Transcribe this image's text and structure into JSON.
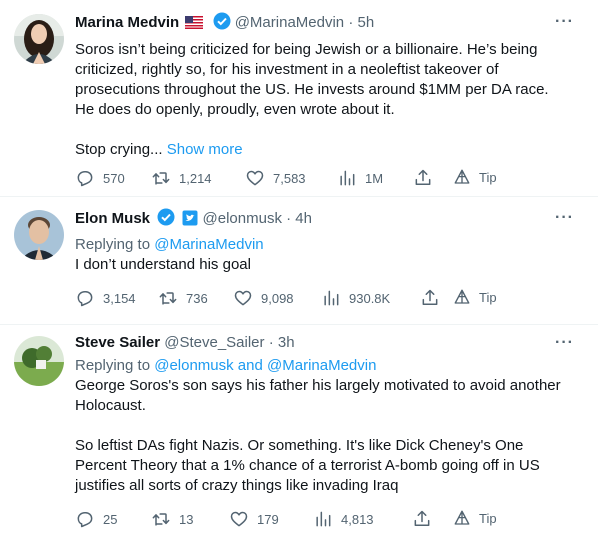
{
  "tweets": [
    {
      "name": "Marina Medvin",
      "flag": "US flag",
      "verified": "blue-check",
      "handle": "@MarinaMedvin",
      "time": "· 5h",
      "body_lines": [
        "Soros isn’t being criticized for being Jewish or a billionaire. He’s being",
        "criticized, rightly so, for his investment in a neoleftist takeover of",
        "prosecutions throughout the US. He invests around $1MM per DA race.",
        "He does do openly, proudly, even wrote about it."
      ],
      "trailing": "Stop crying...",
      "show_more": "Show more",
      "stats": {
        "reply": "570",
        "retweet": "1,214",
        "like": "7,583",
        "views": "1M",
        "tip": "Tip"
      }
    },
    {
      "name": "Elon Musk",
      "verified": "gold-check",
      "affiliation": "twitter-badge",
      "handle": "@elonmusk",
      "time": "· 4h",
      "replying_prefix": "Replying to",
      "replying_to": "@MarinaMedvin",
      "body_lines": [
        "I don’t understand his goal"
      ],
      "stats": {
        "reply": "3,154",
        "retweet": "736",
        "like": "9,098",
        "views": "930.8K",
        "tip": "Tip"
      }
    },
    {
      "name": "Steve Sailer",
      "handle": "@Steve_Sailer",
      "time": "· 3h",
      "replying_prefix": "Replying to",
      "replying_to": "@elonmusk and @MarinaMedvin",
      "body_lines": [
        "George Soros's son says his father his largely motivated to avoid another",
        "Holocaust.",
        "",
        "So leftist DAs fight Nazis. Or something. It's like Dick Cheney's One",
        "Percent Theory that a 1% chance of a terrorist A-bomb going off in US",
        "justifies all sorts of crazy things like invading Iraq"
      ],
      "stats": {
        "reply": "25",
        "retweet": "13",
        "like": "179",
        "views": "4,813",
        "tip": "Tip"
      }
    }
  ],
  "more_label": "···",
  "colors": {
    "accent": "#1d9bf0",
    "muted": "#536471",
    "gold": "#e2b719",
    "text": "#0f1419"
  }
}
